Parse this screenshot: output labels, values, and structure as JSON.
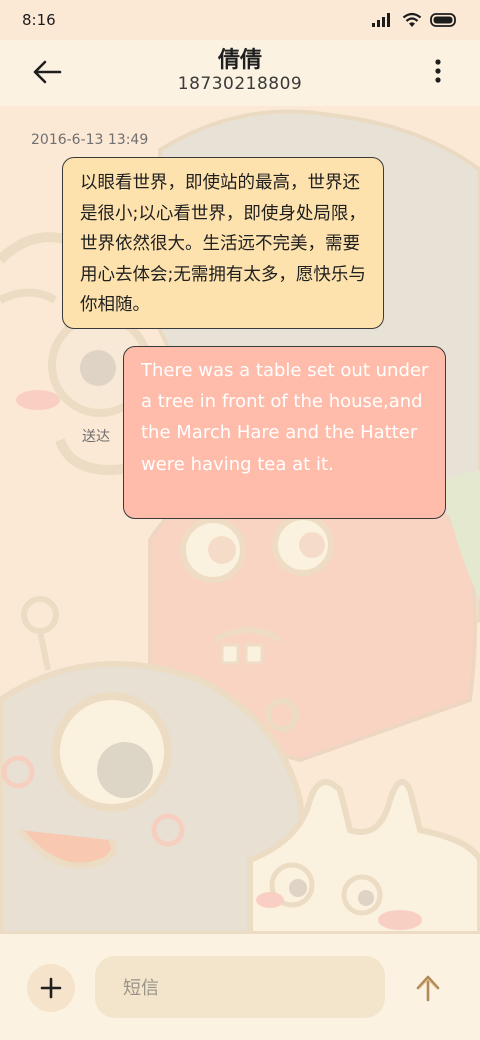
{
  "status_bar": {
    "time": "8:16"
  },
  "header": {
    "contact_name": "倩倩",
    "contact_number": "18730218809"
  },
  "conversation": {
    "timestamp": "2016-6-13 13:49",
    "messages": [
      {
        "direction": "received",
        "text": "以眼看世界，即使站的最高，世界还是很小;以心看世界，即使身处局限，世界依然很大。生活远不完美，需要用心去体会;无需拥有太多，愿快乐与你相随。"
      },
      {
        "direction": "sent",
        "text": "There was a table set out under a tree in front of the house,and the March Hare and the Hatter were having tea at it.",
        "status": "送达"
      }
    ]
  },
  "composer": {
    "placeholder": "短信"
  },
  "colors": {
    "incoming_bubble": "#fde2ae",
    "outgoing_bubble": "#ffbcaa",
    "bar_background": "#fbf2e2"
  },
  "icons": [
    "signal-icon",
    "wifi-icon",
    "battery-icon",
    "back-arrow-icon",
    "more-vertical-icon",
    "plus-icon",
    "send-arrow-icon"
  ]
}
